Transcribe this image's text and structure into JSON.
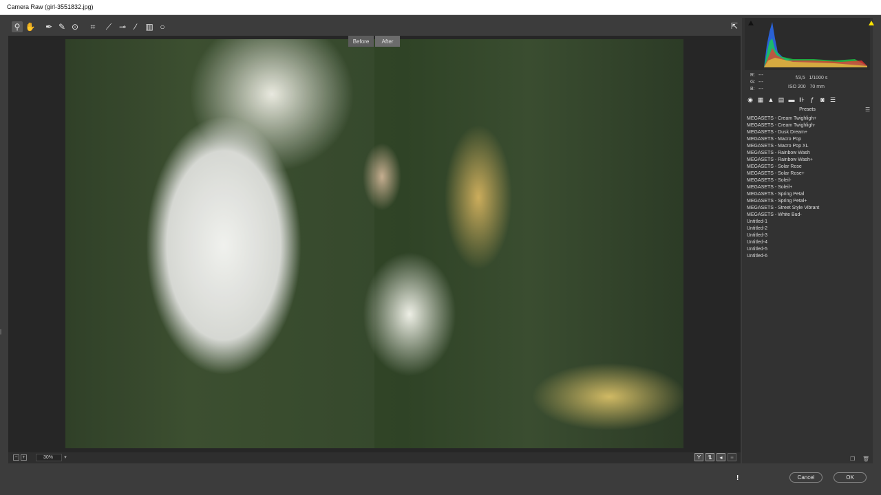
{
  "window": {
    "title": "Camera Raw (girl-3551832.jpg)"
  },
  "toolbar": {
    "tools": [
      {
        "name": "zoom-tool",
        "icon": "magnifier-icon",
        "glyph": "⚲"
      },
      {
        "name": "hand-tool",
        "icon": "hand-icon",
        "glyph": "✋"
      },
      {
        "name": "white-balance-tool",
        "icon": "eyedropper-icon",
        "glyph": "✒"
      },
      {
        "name": "color-sampler-tool",
        "icon": "color-sampler-icon",
        "glyph": "✎"
      },
      {
        "name": "targeted-adjustment-tool",
        "icon": "target-adjust-icon",
        "glyph": "⊙"
      },
      {
        "name": "crop-tool",
        "icon": "crop-icon",
        "glyph": "⌗"
      },
      {
        "name": "straighten-tool",
        "icon": "straighten-icon",
        "glyph": "⟋"
      },
      {
        "name": "spot-removal-tool",
        "icon": "spot-removal-icon",
        "glyph": "⊸"
      },
      {
        "name": "adjustment-brush-tool",
        "icon": "brush-icon",
        "glyph": "⁄"
      },
      {
        "name": "graduated-filter-tool",
        "icon": "graduated-filter-icon",
        "glyph": "▥"
      },
      {
        "name": "radial-filter-tool",
        "icon": "radial-filter-icon",
        "glyph": "○"
      }
    ],
    "export_icon": "export-icon"
  },
  "compare": {
    "before_label": "Before",
    "after_label": "After"
  },
  "bottom": {
    "zoom_value": "30%",
    "zoom_dropdown": "▾"
  },
  "histogram": {
    "rgb": {
      "r_label": "R:",
      "g_label": "G:",
      "b_label": "B:",
      "r_value": "---",
      "g_value": "---",
      "b_value": "---"
    },
    "aperture": "f/3,5",
    "shutter": "1/1000 s",
    "iso": "ISO 200",
    "focal": "70 mm",
    "shadow_clip_color": "#111111",
    "highlight_clip_color": "#ffe400"
  },
  "panel": {
    "tabs": [
      {
        "name": "tab-basic",
        "icon": "aperture-icon",
        "glyph": "◉"
      },
      {
        "name": "tab-tone-curve",
        "icon": "tone-curve-icon",
        "glyph": "▦"
      },
      {
        "name": "tab-detail",
        "icon": "detail-icon",
        "glyph": "▲"
      },
      {
        "name": "tab-hsl",
        "icon": "hsl-icon",
        "glyph": "▤"
      },
      {
        "name": "tab-split-toning",
        "icon": "split-toning-icon",
        "glyph": "▬"
      },
      {
        "name": "tab-lens",
        "icon": "lens-icon",
        "glyph": "⊪"
      },
      {
        "name": "tab-effects",
        "icon": "fx-icon",
        "glyph": "ƒ"
      },
      {
        "name": "tab-calibration",
        "icon": "camera-icon",
        "glyph": "◙"
      },
      {
        "name": "tab-presets",
        "icon": "presets-icon",
        "glyph": "☰"
      }
    ],
    "presets_title": "Presets",
    "presets": [
      "MEGASETS - Cream Twighligh+",
      "MEGASETS - Cream Twighligh-",
      "MEGASETS - Dusk Dream+",
      "MEGASETS - Macro Pop",
      "MEGASETS - Macro Pop XL",
      "MEGASETS - Rainbow Wash",
      "MEGASETS - Rainbow Wash+",
      "MEGASETS - Solar Rose",
      "MEGASETS - Solar Rose+",
      "MEGASETS - Soleil-",
      "MEGASETS - Soleil+",
      "MEGASETS - Spring Petal",
      "MEGASETS - Spring Petal+",
      "MEGASETS - Street Style Vibrant",
      "MEGASETS - White Bud-",
      "Untitled-1",
      "Untitled-2",
      "Untitled-3",
      "Untitled-4",
      "Untitled-5",
      "Untitled-6"
    ]
  },
  "buttons": {
    "cancel_label": "Cancel",
    "ok_label": "OK"
  }
}
